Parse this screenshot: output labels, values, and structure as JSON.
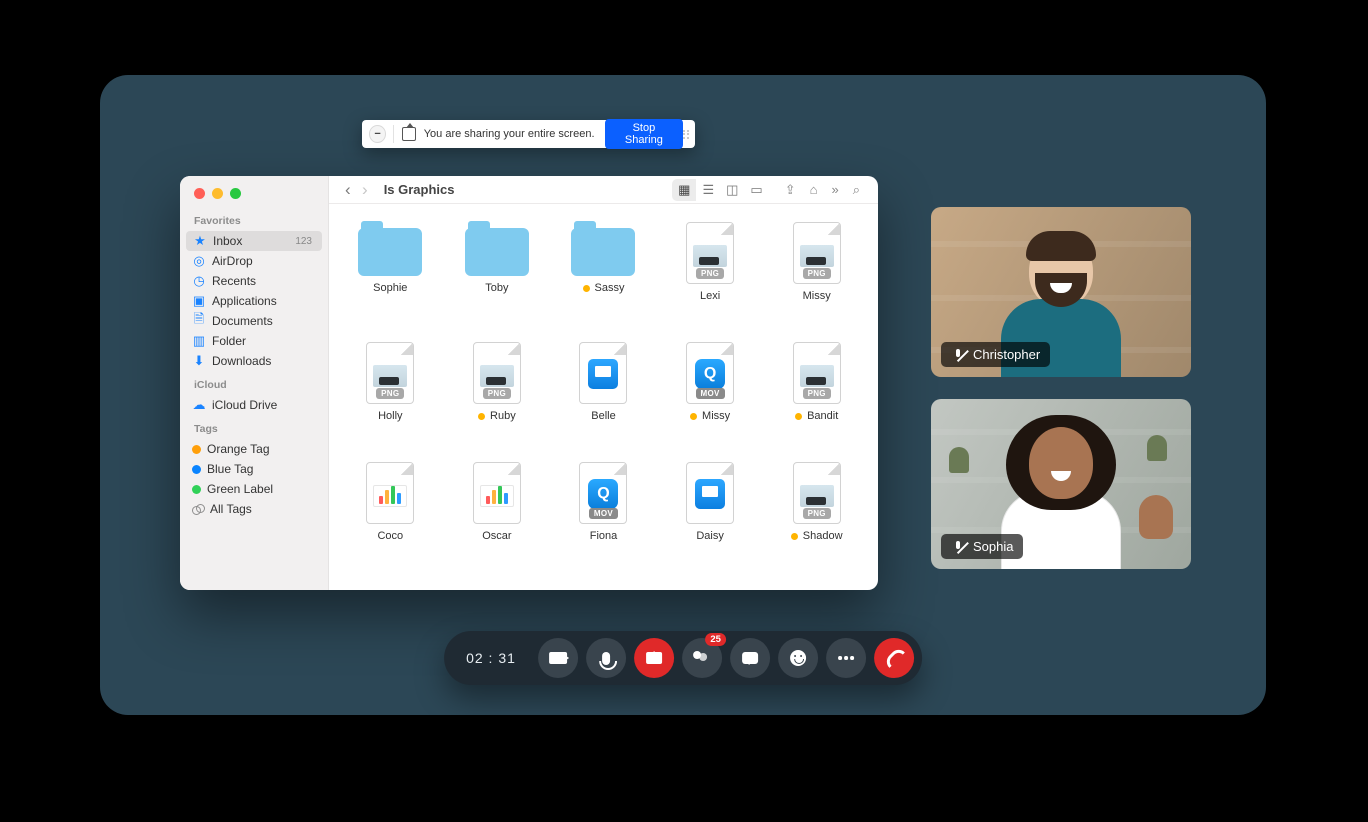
{
  "share_bar": {
    "message": "You are sharing your entire screen.",
    "stop_label": "Stop Sharing"
  },
  "finder": {
    "title": "Is Graphics",
    "sidebar": {
      "sections": {
        "favorites": "Favorites",
        "icloud": "iCloud",
        "tags": "Tags"
      },
      "favorites": [
        {
          "label": "Inbox",
          "icon": "star",
          "badge": "123",
          "active": true
        },
        {
          "label": "AirDrop",
          "icon": "airdrop"
        },
        {
          "label": "Recents",
          "icon": "clock"
        },
        {
          "label": "Applications",
          "icon": "app"
        },
        {
          "label": "Documents",
          "icon": "doc"
        },
        {
          "label": "Folder",
          "icon": "folder"
        },
        {
          "label": "Downloads",
          "icon": "download"
        }
      ],
      "icloud": [
        {
          "label": "iCloud Drive",
          "icon": "icloud"
        }
      ],
      "tags": [
        {
          "label": "Orange Tag",
          "color": "o"
        },
        {
          "label": "Blue Tag",
          "color": "b"
        },
        {
          "label": "Green Label",
          "color": "g"
        },
        {
          "label": "All Tags",
          "color": "all"
        }
      ]
    },
    "items": [
      {
        "name": "Sophie",
        "kind": "folder",
        "tagged": false
      },
      {
        "name": "Toby",
        "kind": "folder",
        "tagged": false
      },
      {
        "name": "Sassy",
        "kind": "folder",
        "tagged": true
      },
      {
        "name": "Lexi",
        "kind": "png",
        "tagged": false
      },
      {
        "name": "Missy",
        "kind": "png",
        "tagged": false
      },
      {
        "name": "Holly",
        "kind": "png",
        "tagged": false
      },
      {
        "name": "Ruby",
        "kind": "png",
        "tagged": true
      },
      {
        "name": "Belle",
        "kind": "key",
        "tagged": false
      },
      {
        "name": "Missy",
        "kind": "mov",
        "tagged": true
      },
      {
        "name": "Bandit",
        "kind": "png",
        "tagged": true
      },
      {
        "name": "Coco",
        "kind": "chart",
        "tagged": false
      },
      {
        "name": "Oscar",
        "kind": "chart",
        "tagged": false
      },
      {
        "name": "Fiona",
        "kind": "mov",
        "tagged": false
      },
      {
        "name": "Daisy",
        "kind": "key",
        "tagged": false
      },
      {
        "name": "Shadow",
        "kind": "png",
        "tagged": true
      }
    ]
  },
  "participants": [
    {
      "name": "Christopher",
      "muted": true
    },
    {
      "name": "Sophia",
      "muted": true
    }
  ],
  "controls": {
    "timer": "02 : 31",
    "participants_badge": "25"
  }
}
